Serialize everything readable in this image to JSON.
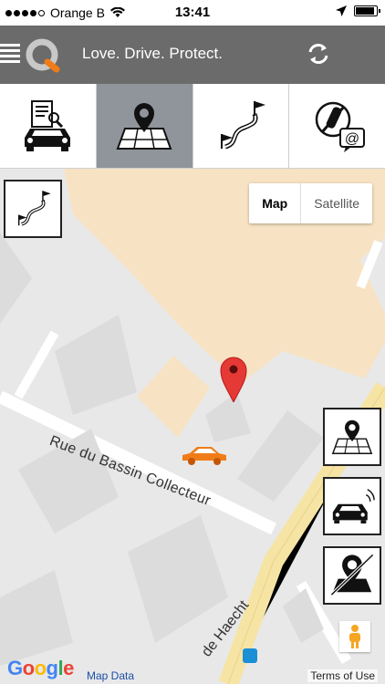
{
  "status": {
    "carrier": "Orange B",
    "time": "13:41",
    "signal_bars": 4,
    "signal_total": 5
  },
  "header": {
    "tagline": "Love. Drive. Protect.",
    "icons": {
      "menu": "menu-icon",
      "logo": "app-logo-icon",
      "refresh": "refresh-icon"
    }
  },
  "tabs": [
    {
      "id": "vehicle-info",
      "icon": "car-document-icon",
      "active": false
    },
    {
      "id": "map-location",
      "icon": "map-pin-icon",
      "active": true
    },
    {
      "id": "route",
      "icon": "route-flag-icon",
      "active": false
    },
    {
      "id": "alerts",
      "icon": "key-email-icon",
      "active": false
    }
  ],
  "map": {
    "toggle": {
      "map_label": "Map",
      "satellite_label": "Satellite",
      "selected": "Map"
    },
    "streets": [
      "Rue du Bassin Collecteur",
      "de Haecht"
    ],
    "attribution": {
      "google": "Google",
      "map_data": "Map Data",
      "terms": "Terms of Use"
    },
    "colors": {
      "building": "#f7e3c3",
      "road": "#ffffff",
      "major_road": "#f6e4a4",
      "pin": "#e53935",
      "car": "#f07c18"
    },
    "side_buttons": [
      "map-pin-icon",
      "car-alarm-icon",
      "no-location-icon"
    ]
  }
}
